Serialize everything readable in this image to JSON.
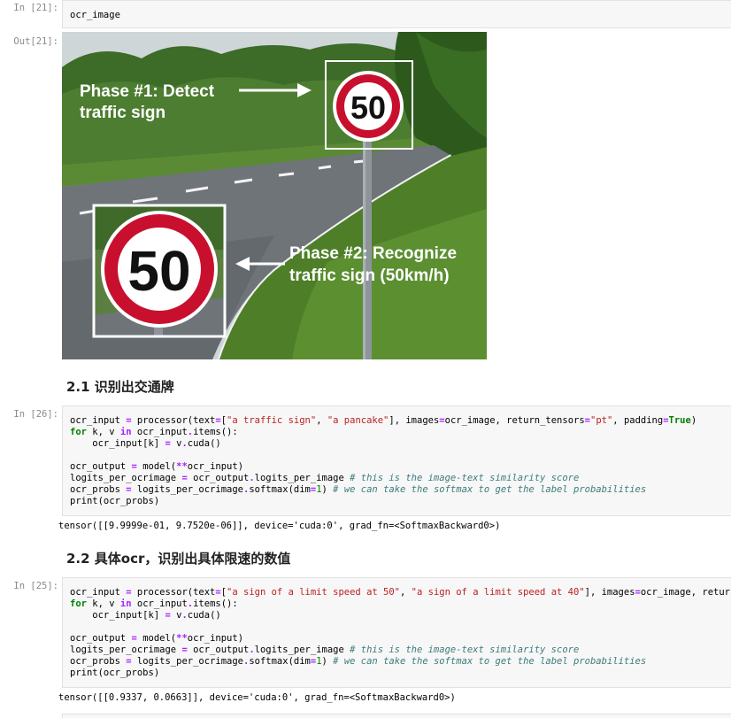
{
  "cells": {
    "c21": {
      "in_prompt": "In [21]:",
      "code": "ocr_image",
      "out_prompt": "Out[21]:"
    },
    "c26": {
      "in_prompt": "In [26]:",
      "output": "tensor([[9.9999e-01, 9.7520e-06]], device='cuda:0', grad_fn=<SoftmaxBackward0>)"
    },
    "c25": {
      "in_prompt": "In [25]:",
      "output": "tensor([[0.9337, 0.0663]], device='cuda:0', grad_fn=<SoftmaxBackward0>)"
    }
  },
  "headings": {
    "h1": "2.1 识别出交通牌",
    "h2": "2.2 具体ocr，识别出具体限速的数值"
  },
  "figure": {
    "phase1_line1": "Phase #1: Detect",
    "phase1_line2": "traffic sign",
    "phase2_line1": "Phase #2: Recognize",
    "phase2_line2": "traffic sign (50km/h)",
    "sign_small": "50",
    "sign_large": "50",
    "colors": {
      "sign_red": "#c8102e",
      "road": "#6e7378",
      "grass": "#4f7a2a",
      "trees": "#2f5a1f",
      "sky": "#d8dde0"
    }
  }
}
